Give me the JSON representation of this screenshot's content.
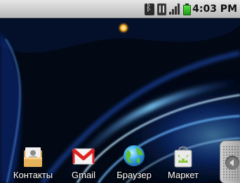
{
  "status_bar": {
    "time": "4:03 PM",
    "icons": [
      "bluetooth-icon",
      "network-3g-icon",
      "signal-strength-icon",
      "battery-icon"
    ],
    "battery_color": "#2bc21e"
  },
  "wallpaper": {
    "background": "#020814",
    "glow_colors": [
      "#1a5cff",
      "#58b8ff",
      "#c8e6ff"
    ]
  },
  "dock": {
    "items": [
      {
        "label": "Контакты",
        "icon": "contacts-icon"
      },
      {
        "label": "Gmail",
        "icon": "gmail-icon"
      },
      {
        "label": "Браузер",
        "icon": "browser-icon"
      },
      {
        "label": "Маркет",
        "icon": "market-icon"
      }
    ]
  },
  "drawer_handle": {
    "icon": "chevron-left-icon"
  }
}
